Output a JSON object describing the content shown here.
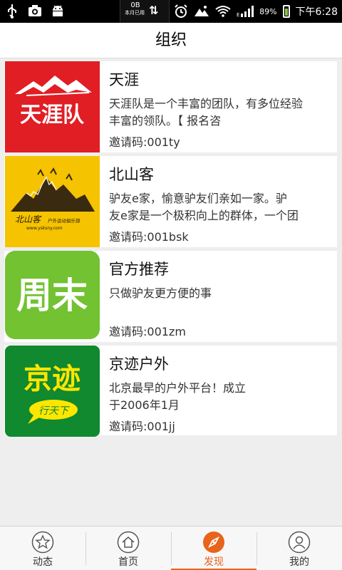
{
  "statusbar": {
    "data_num": "0B",
    "data_label": "本月已用",
    "battery_pct": "89%",
    "time": "下午6:28",
    "icons": [
      "usb-icon",
      "camera-icon",
      "android-icon",
      "data-arrows-icon",
      "alarm-icon",
      "weather-icon",
      "wifi-icon",
      "signal-icon",
      "battery-icon"
    ]
  },
  "header": {
    "title": "组织"
  },
  "orgs": [
    {
      "name": "天涯",
      "desc": "天涯队是一个丰富的团队，有多位经验\n丰富的领队。【 报名咨",
      "code": "邀请码:001ty",
      "logo_text": "天涯队"
    },
    {
      "name": "北山客",
      "desc": "驴友e家，愉意驴友们亲如一家。驴\n友e家是一个极积向上的群体，一个团",
      "code": "邀请码:001bsk",
      "logo_text": "北山客",
      "logo_sub": "户外运动俱乐部",
      "logo_url": "www.ysksny.com"
    },
    {
      "name": "官方推荐",
      "desc": "只做驴友更方便的事",
      "code": "邀请码:001zm",
      "logo_text": "周末"
    },
    {
      "name": "京迹户外",
      "desc": "北京最早的户外平台！成立\n于2006年1月",
      "code": "邀请码:001jj",
      "logo_text": "京迹",
      "logo_sub": "行天下"
    }
  ],
  "tabs": [
    {
      "label": "动态",
      "icon": "star-icon"
    },
    {
      "label": "首页",
      "icon": "home-icon"
    },
    {
      "label": "发现",
      "icon": "compass-icon",
      "active": true
    },
    {
      "label": "我的",
      "icon": "user-icon"
    }
  ],
  "colors": {
    "accent": "#e8641c",
    "tianya_red": "#e01e24",
    "beishan_yellow": "#f5c300",
    "zhoumo_green": "#72c232",
    "jingji_green": "#10892f"
  }
}
